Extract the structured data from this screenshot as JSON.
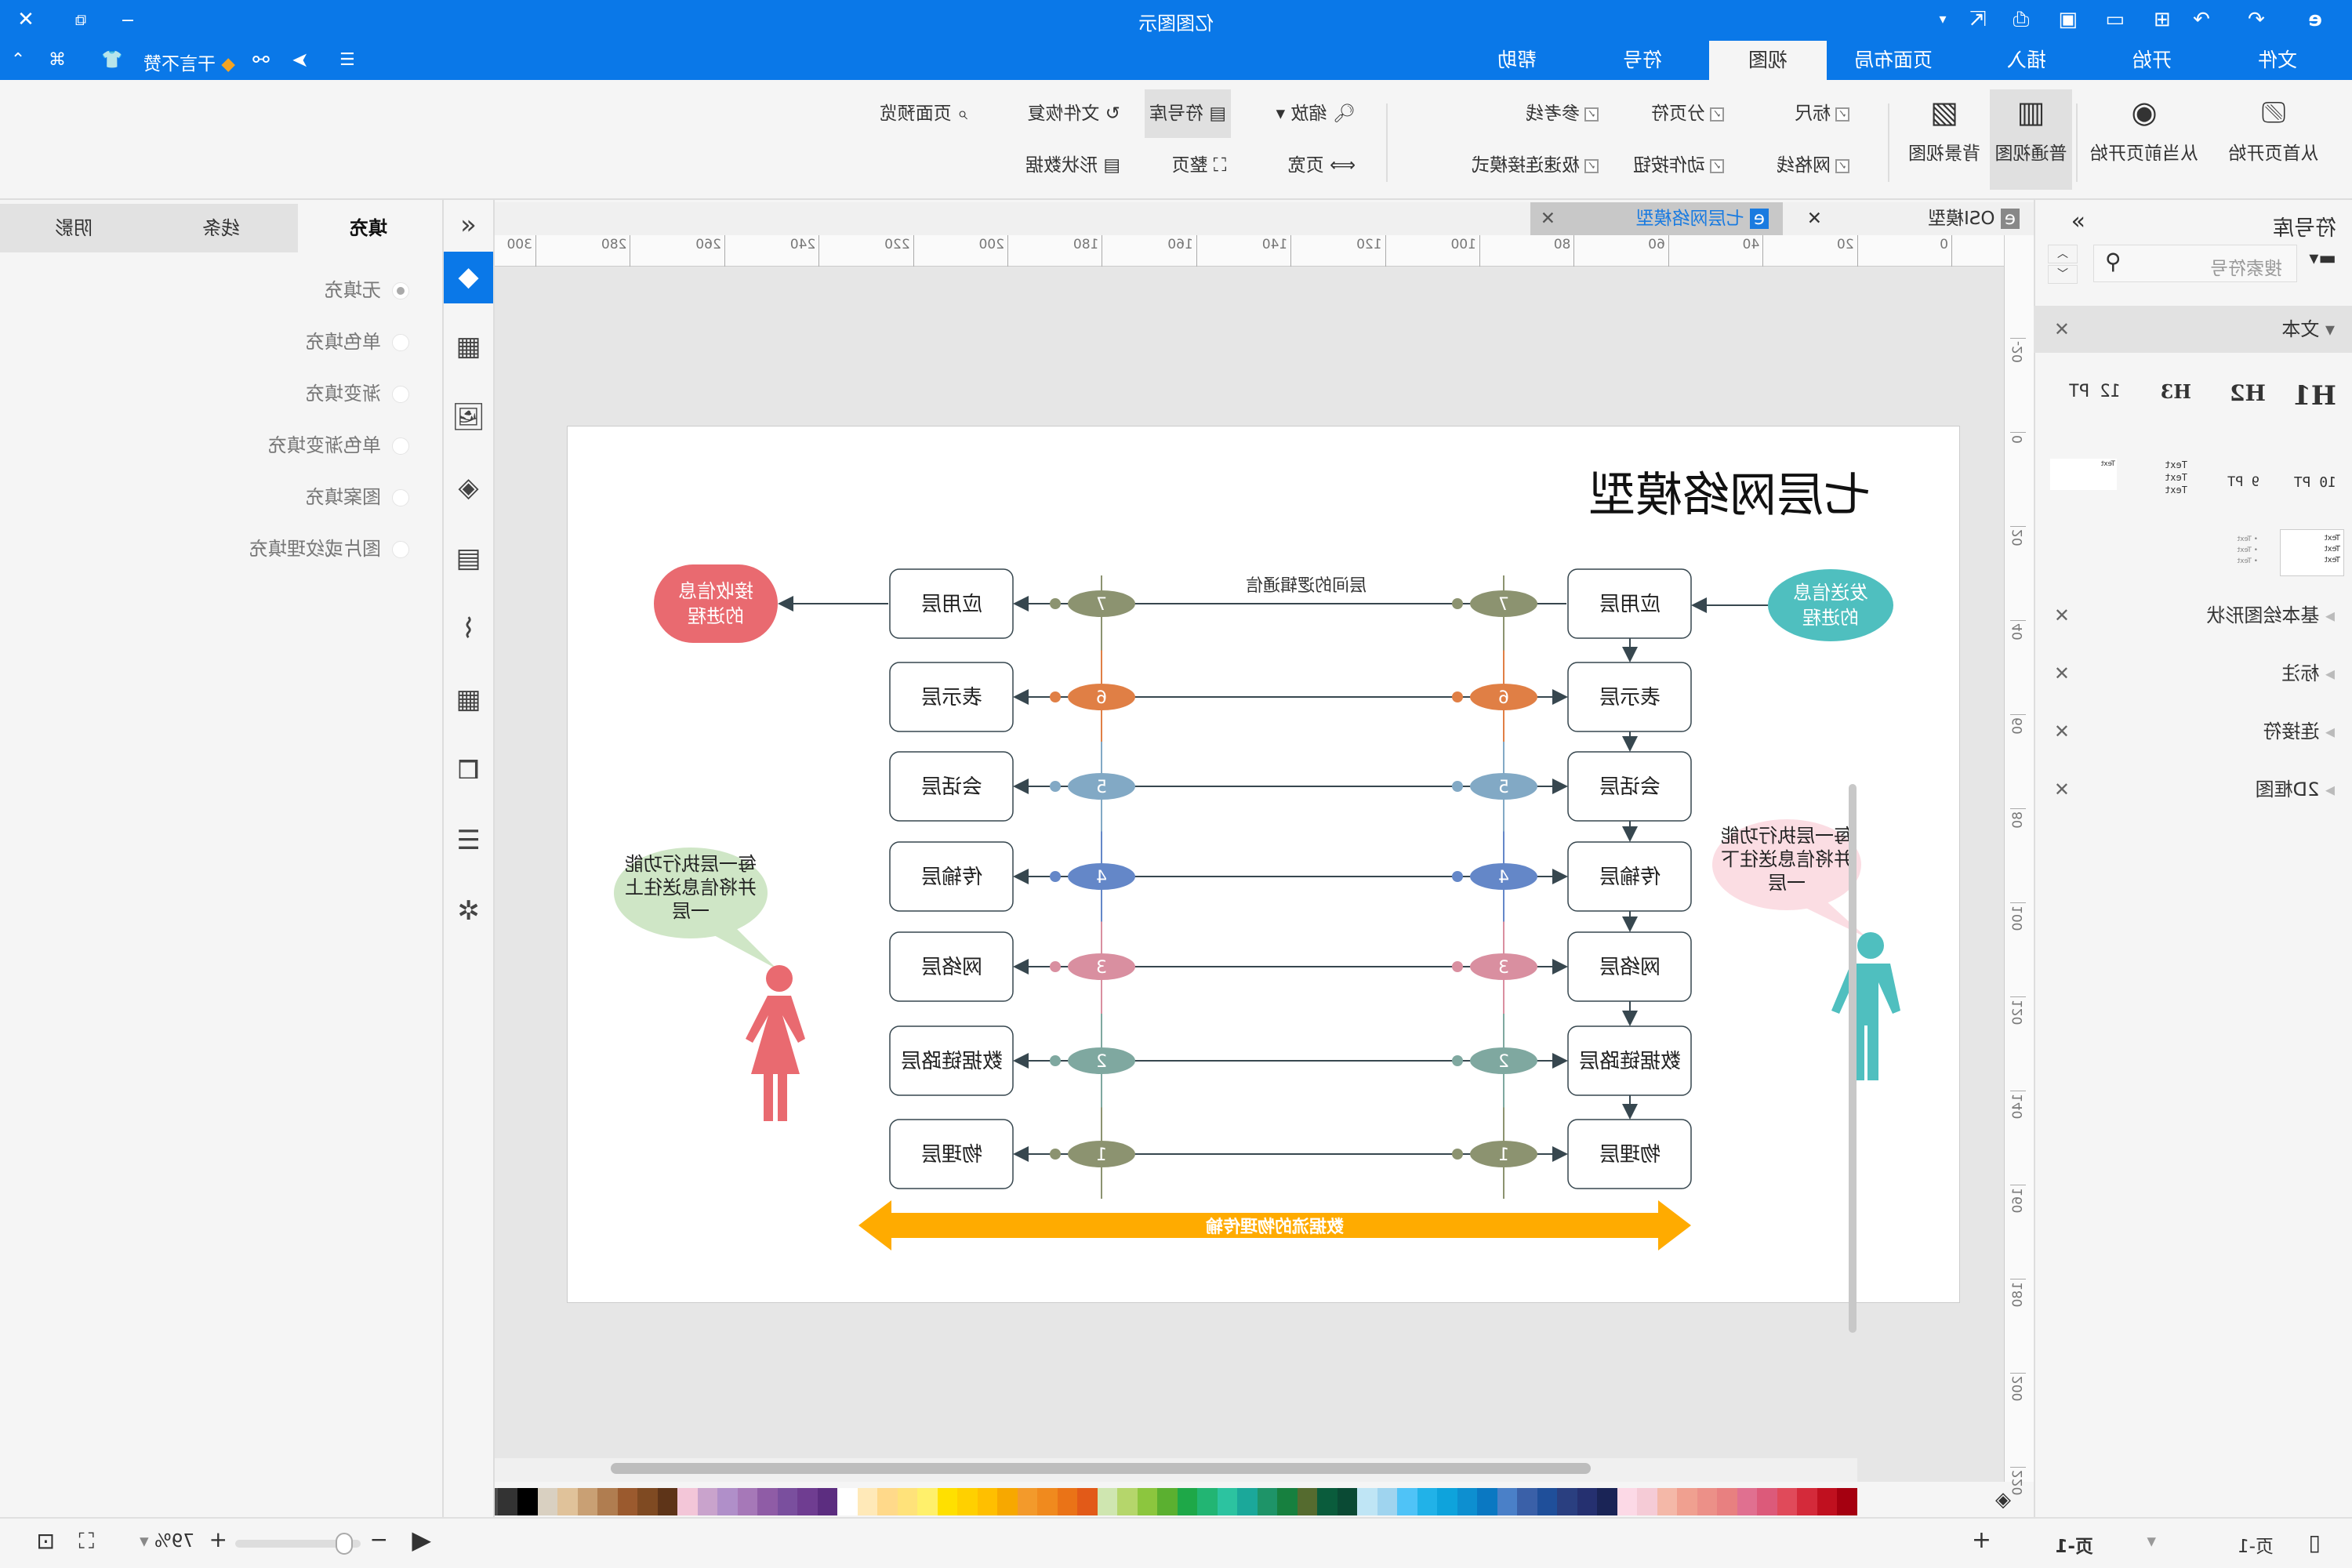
{
  "app": {
    "title": "亿图图示",
    "promo": "干言不赞"
  },
  "menu": {
    "tabs": [
      "文件",
      "开始",
      "插入",
      "页面布局",
      "视图",
      "符号",
      "帮助"
    ],
    "active": "视图"
  },
  "ribbon": {
    "from_first": "从首页开始",
    "from_current": "从当前页开始",
    "normal_view": "普通视图",
    "bg_view": "背景视图",
    "ruler": "标尺",
    "grid": "网格线",
    "page_break": "分页符",
    "action_button": "动作按钮",
    "guides": "参考线",
    "quick_connect": "极速连接模式",
    "zoom": "缩放",
    "page_width": "页宽",
    "library": "符号库",
    "whole_page": "整页",
    "file_recovery": "文件恢复",
    "shape_data": "形状数据",
    "page_preview": "页面预览"
  },
  "library": {
    "title": "符号库",
    "search_placeholder": "搜索符号",
    "section_text": "文本",
    "text_samples": [
      "H1",
      "H2",
      "H3",
      "12 PT",
      "10 PT",
      "9 PT",
      "Text"
    ],
    "categories": [
      "基本绘图形状",
      "标注",
      "连接符",
      "2D框图"
    ]
  },
  "doc_tabs": [
    {
      "label": "OSI模型",
      "active": false
    },
    {
      "label": "七层网络模型",
      "active": true
    }
  ],
  "ruler": {
    "h": [
      0,
      20,
      40,
      60,
      80,
      100,
      120,
      140,
      160,
      180,
      200,
      220,
      240,
      260,
      280,
      300
    ],
    "v": [
      -20,
      0,
      20,
      40,
      60,
      80,
      100,
      120,
      140,
      160,
      180,
      200,
      220
    ]
  },
  "props": {
    "tabs": [
      "填充",
      "线条",
      "阴影"
    ],
    "options": [
      "无填充",
      "单色填充",
      "渐变填充",
      "单色渐变填充",
      "图案填充",
      "图片或纹理填充"
    ],
    "selected": "无填充"
  },
  "diagram": {
    "title": "七层网络模型",
    "sender": "发送信息的进程",
    "sender_lines": [
      "发送信息",
      "的进程"
    ],
    "receiver_lines": [
      "接收信息",
      "的进程"
    ],
    "logical": "层间的逻辑通信",
    "physical": "数据流的物理传输",
    "bubble_right_lines": [
      "每一层执行功能",
      "并将信息送往下",
      "一层"
    ],
    "bubble_left_lines": [
      "每一层执行功能",
      "并将信息送往上",
      "一层"
    ],
    "layers": [
      {
        "num": "7",
        "name": "应用层",
        "color": "#8c9370"
      },
      {
        "num": "6",
        "name": "表示层",
        "color": "#e07f45"
      },
      {
        "num": "5",
        "name": "会话层",
        "color": "#82a9c5"
      },
      {
        "num": "4",
        "name": "传输层",
        "color": "#6487c8"
      },
      {
        "num": "3",
        "name": "网络层",
        "color": "#d98fa0"
      },
      {
        "num": "2",
        "name": "数据链路层",
        "color": "#7fa8a0"
      },
      {
        "num": "1",
        "name": "物理层",
        "color": "#8c9370"
      }
    ],
    "colors": {
      "sender": "#4fbfbf",
      "receiver": "#e96a70",
      "arrow": "#ffab00",
      "bubble_pink": "#fbdde3",
      "bubble_green": "#cfe6c6",
      "man": "#4fbfbf",
      "woman": "#e96a70"
    }
  },
  "status": {
    "page_tab": "页-1",
    "current_page": "页-1",
    "zoom": "79%"
  },
  "palette": [
    "#ffffff",
    "#e6e6e6",
    "#d9d9d9",
    "#c8c8c8",
    "#b3b3b3",
    "#999999",
    "#808080",
    "#666666",
    "#4d4d4d",
    "#333333",
    "#000000",
    "#d9d0c1",
    "#e0c29a",
    "#c9a074",
    "#b07d50",
    "#9b5a2e",
    "#7f4a22",
    "#5e3418",
    "#f3c6d8",
    "#c9a3cc",
    "#b08fc9",
    "#a678b8",
    "#8f5ca6",
    "#7a4f9e",
    "#6f3d91",
    "#5c2d80",
    "#ffffff",
    "#ffe9b8",
    "#ffd98a",
    "#ffe27a",
    "#fff06b",
    "#ffe000",
    "#ffd000",
    "#ffbf00",
    "#f7a800",
    "#f39a2b",
    "#f08a1e",
    "#ea7317",
    "#e25a18",
    "#cfe6b0",
    "#b5d66b",
    "#8cc63e",
    "#5bb030",
    "#1ea848",
    "#22b573",
    "#2cc3a0",
    "#1ba89a",
    "#1e9468",
    "#17803f",
    "#556b2f",
    "#0a5c3c",
    "#0a4a34",
    "#bfe5f5",
    "#9fd4ef",
    "#4fc3f7",
    "#21b2e8",
    "#0ea3dc",
    "#0d8fd0",
    "#0a78c2",
    "#4a80c8",
    "#3a60a8",
    "#1f4f9a",
    "#2a3f80",
    "#253070",
    "#1a2456",
    "#fcd9e6",
    "#f5cbd6",
    "#f4b8a8",
    "#f0a090",
    "#ec9088",
    "#e88080",
    "#e07090",
    "#dc5a7a",
    "#e04a5a",
    "#d42a3a",
    "#c0101f",
    "#a50010"
  ]
}
